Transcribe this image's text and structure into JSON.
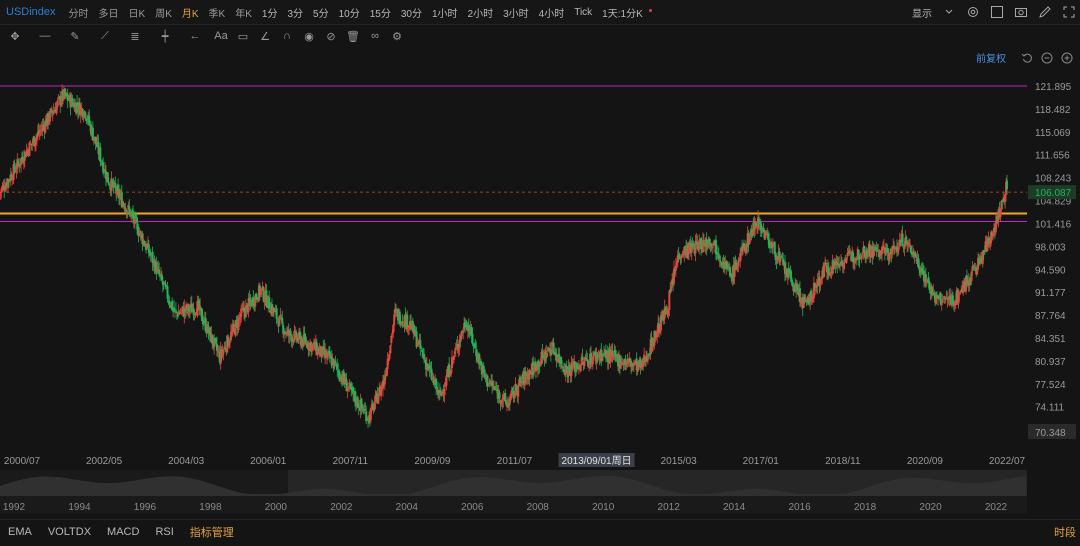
{
  "header": {
    "symbol": "USDindex",
    "periods": [
      {
        "label": "分时",
        "active": false
      },
      {
        "label": "多日",
        "active": false
      },
      {
        "label": "日K",
        "active": false
      },
      {
        "label": "周K",
        "active": false
      },
      {
        "label": "月K",
        "active": true
      },
      {
        "label": "季K",
        "active": false
      },
      {
        "label": "年K",
        "active": false
      },
      {
        "label": "1分",
        "active": false
      },
      {
        "label": "3分",
        "active": false
      },
      {
        "label": "5分",
        "active": false
      },
      {
        "label": "10分",
        "active": false
      },
      {
        "label": "15分",
        "active": false
      },
      {
        "label": "30分",
        "active": false
      },
      {
        "label": "1小时",
        "active": false
      },
      {
        "label": "2小时",
        "active": false
      },
      {
        "label": "3小时",
        "active": false
      },
      {
        "label": "4小时",
        "active": false
      },
      {
        "label": "Tick",
        "active": false
      },
      {
        "label": "1天:1分K",
        "active": false
      }
    ],
    "display_label": "显示",
    "adjust_label": "前复权"
  },
  "toolbar": {
    "tools": [
      "move-tool-icon",
      "line-tool-icon",
      "pencil-tool-icon",
      "zigzag-tool-icon",
      "fib-tool-icon",
      "cross-tool-icon",
      "arrow-tool-icon",
      "text-tool-icon",
      "comment-tool-icon",
      "angle-tool-icon",
      "magnet-tool-icon",
      "eye-tool-icon",
      "hide-tool-icon",
      "trash-tool-icon",
      "link-tool-icon",
      "settings-tool-icon"
    ],
    "text_tool_label": "Aa"
  },
  "indicators": [
    "EMA",
    "VOLTDX",
    "MACD",
    "RSI"
  ],
  "indicator_manage_label": "指标管理",
  "timeshare_label": "时段",
  "colors": {
    "up": "#e8463c",
    "down": "#22b55a",
    "hline_orange": "#f5a623",
    "hline_magenta": "#c026c6",
    "accent": "#e6a23c"
  },
  "chart_data": {
    "type": "candlestick",
    "title": "USDindex",
    "price_ticks": [
      "121.895",
      "118.482",
      "115.069",
      "111.656",
      "108.243",
      "104.829",
      "101.416",
      "98.003",
      "94.590",
      "91.177",
      "87.764",
      "84.351",
      "80.937",
      "77.524",
      "74.111",
      "70.348"
    ],
    "ylim": [
      70.348,
      121.895
    ],
    "last_price": "106.087",
    "last_price_value": 106.087,
    "horizontal_lines": [
      {
        "value": 121.9,
        "color": "magenta"
      },
      {
        "value": 102.9,
        "color": "orange"
      },
      {
        "value": 101.7,
        "color": "magenta"
      }
    ],
    "x_ticks": [
      "2000/07",
      "2002/05",
      "2004/03",
      "2006/01",
      "2007/11",
      "2009/09",
      "2011/07",
      "2013/09/01周日",
      "2015/03",
      "2017/01",
      "2018/11",
      "2020/09",
      "2022/07"
    ],
    "highlighted_x_tick": "2013/09/01周日",
    "overview_ticks": [
      "1992",
      "1994",
      "1996",
      "1998",
      "2000",
      "2002",
      "2004",
      "2006",
      "2008",
      "2010",
      "2012",
      "2014",
      "2016",
      "2018",
      "2020",
      "2022"
    ],
    "anchors": [
      [
        "2000/01",
        106
      ],
      [
        "2000/08",
        112
      ],
      [
        "2001/02",
        117
      ],
      [
        "2001/06",
        120.5
      ],
      [
        "2001/12",
        118
      ],
      [
        "2002/06",
        108
      ],
      [
        "2002/12",
        103
      ],
      [
        "2003/06",
        96
      ],
      [
        "2003/12",
        88
      ],
      [
        "2004/06",
        89
      ],
      [
        "2004/12",
        81.5
      ],
      [
        "2005/06",
        88
      ],
      [
        "2005/11",
        91.5
      ],
      [
        "2006/06",
        85
      ],
      [
        "2006/12",
        83.5
      ],
      [
        "2007/06",
        81
      ],
      [
        "2007/12",
        75.5
      ],
      [
        "2008/04",
        72.5
      ],
      [
        "2008/08",
        78
      ],
      [
        "2008/11",
        88
      ],
      [
        "2009/03",
        86.5
      ],
      [
        "2009/11",
        75.5
      ],
      [
        "2010/06",
        87
      ],
      [
        "2010/11",
        78.5
      ],
      [
        "2011/05",
        74.5
      ],
      [
        "2011/09",
        78
      ],
      [
        "2012/05",
        83
      ],
      [
        "2012/09",
        79.5
      ],
      [
        "2013/06",
        82
      ],
      [
        "2014/05",
        80
      ],
      [
        "2014/12",
        89
      ],
      [
        "2015/03",
        97
      ],
      [
        "2015/12",
        99
      ],
      [
        "2016/05",
        93.5
      ],
      [
        "2016/12",
        102
      ],
      [
        "2017/06",
        96
      ],
      [
        "2018/01",
        89
      ],
      [
        "2018/06",
        94.5
      ],
      [
        "2019/05",
        97.5
      ],
      [
        "2019/12",
        97
      ],
      [
        "2020/03",
        99
      ],
      [
        "2020/06",
        97
      ],
      [
        "2020/12",
        90
      ],
      [
        "2021/05",
        90
      ],
      [
        "2021/12",
        96
      ],
      [
        "2022/05",
        103
      ],
      [
        "2022/09",
        111
      ],
      [
        "2022/11",
        106.1
      ]
    ]
  }
}
